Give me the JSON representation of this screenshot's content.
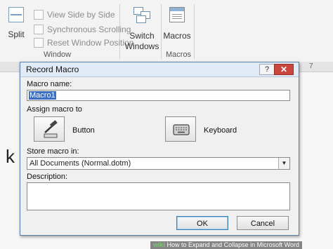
{
  "ribbon": {
    "split_label": "Split",
    "view_side_by_side": "View Side by Side",
    "synchronous_scrolling": "Synchronous Scrolling",
    "reset_window_position": "Reset Window Position",
    "window_group": "Window",
    "switch_windows_line1": "Switch",
    "switch_windows_line2": "Windows",
    "macros_label": "Macros",
    "macros_group": "Macros"
  },
  "ruler": {
    "right_mark": "7"
  },
  "document": {
    "visible_char": "k"
  },
  "dialog": {
    "title": "Record Macro",
    "help_label": "?",
    "close_label": "✕",
    "macro_name_label": "Macro name:",
    "macro_name_value": "Macro1",
    "assign_label": "Assign macro to",
    "button_label": "Button",
    "keyboard_label": "Keyboard",
    "store_label": "Store macro in:",
    "store_value": "All Documents (Normal.dotm)",
    "description_label": "Description:",
    "description_value": "",
    "ok_label": "OK",
    "cancel_label": "Cancel"
  },
  "watermark": {
    "brand": "wiki",
    "text": "How to Expand and Collapse in Microsoft Word"
  },
  "icons": [
    "split-icon",
    "view-side-by-side-icon",
    "sync-scrolling-icon",
    "reset-window-icon",
    "switch-windows-icon",
    "macros-icon",
    "hammer-icon",
    "keyboard-icon",
    "dropdown-arrow-icon"
  ]
}
